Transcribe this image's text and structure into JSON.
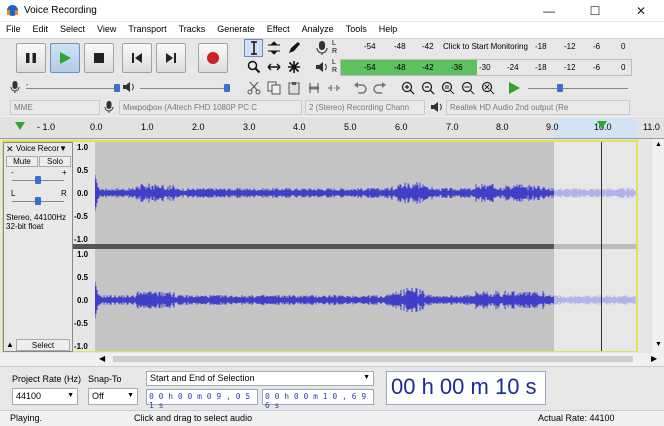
{
  "window": {
    "title": "Voice Recording"
  },
  "menu": [
    "File",
    "Edit",
    "Select",
    "View",
    "Transport",
    "Tracks",
    "Generate",
    "Effect",
    "Analyze",
    "Tools",
    "Help"
  ],
  "meter": {
    "record_scale": [
      "-54",
      "-48",
      "-42",
      "-18",
      "-12",
      "-6",
      "0"
    ],
    "record_hint": "Click to Start Monitoring",
    "playback_scale": [
      "-54",
      "-48",
      "-42",
      "-36",
      "-30",
      "-24",
      "-18",
      "-12",
      "-6",
      "0"
    ],
    "channel_l": "L",
    "channel_r": "R",
    "playback_level_fraction": 0.47
  },
  "devices": {
    "host": "MME",
    "input": "Микрофон (A4tech FHD 1080P PC C",
    "channels": "2 (Stereo) Recording Chann",
    "output": "Realtek HD Audio 2nd output (Re"
  },
  "ruler": {
    "ticks": [
      "- 1.0",
      "0.0",
      "1.0",
      "2.0",
      "3.0",
      "4.0",
      "5.0",
      "6.0",
      "7.0",
      "8.0",
      "9.0",
      "10.0",
      "11.0"
    ],
    "selection_start_seconds": 9.051,
    "selection_end_seconds": 10.696
  },
  "track": {
    "name": "Voice Recor",
    "mute": "Mute",
    "solo": "Solo",
    "gain_minus": "-",
    "gain_plus": "+",
    "pan_l": "L",
    "pan_r": "R",
    "info_line1": "Stereo, 44100Hz",
    "info_line2": "32-bit float",
    "select": "Select",
    "scale_top": [
      "1.0",
      "0.5",
      "0.0",
      "-0.5",
      "-1.0"
    ],
    "scale_bottom": [
      "1.0",
      "0.5",
      "0.0",
      "-0.5",
      "-1.0"
    ]
  },
  "bottom": {
    "project_rate_label": "Project Rate (Hz)",
    "project_rate_value": "44100",
    "snap_to_label": "Snap-To",
    "snap_to_value": "Off",
    "selection_mode": "Start and End of Selection",
    "start_time": "0 0 h 0 0 m 0 9 , 0 5 1 s",
    "end_time": "0 0 h 0 0 m 1 0 , 6 9 6 s",
    "big_time": "00 h 00 m 10 s"
  },
  "status": {
    "state": "Playing.",
    "hint": "Click and drag to select audio",
    "rate": "Actual Rate: 44100"
  },
  "colors": {
    "wave": "#3f3fc8",
    "wave_bg": "#c4c4c4",
    "meter_green": "#5ec05e",
    "play_green": "#2fa52f",
    "record_red": "#cc2222"
  }
}
